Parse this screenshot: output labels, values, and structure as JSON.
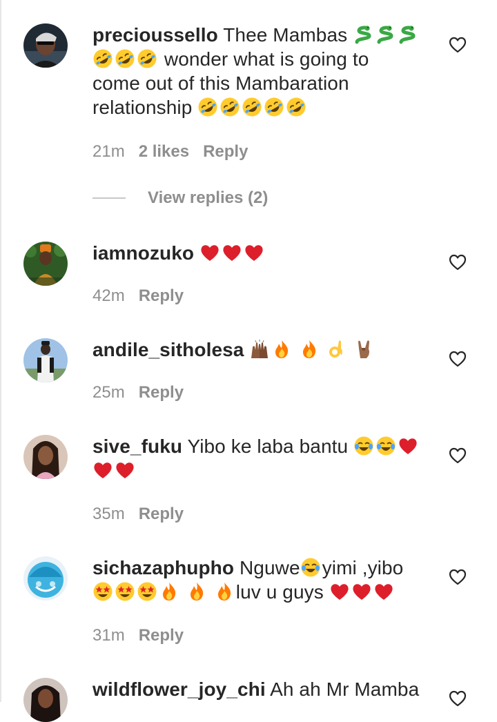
{
  "comments": [
    {
      "username": "precioussello",
      "text_1": "Thee Mambas",
      "text_2": "wonder what is going to",
      "text_3": "come out of this Mambaration",
      "text_4": "relationship",
      "time": "21m",
      "likes": "2 likes",
      "reply": "Reply",
      "view_replies": "View replies (2)"
    },
    {
      "username": "iamnozuko",
      "time": "42m",
      "reply": "Reply"
    },
    {
      "username": "andile_sitholesa",
      "time": "25m",
      "reply": "Reply"
    },
    {
      "username": "sive_fuku",
      "text_1": "Yibo ke laba bantu",
      "time": "35m",
      "reply": "Reply"
    },
    {
      "username": "sichazaphupho",
      "text_1": "Nguwe",
      "text_2": "yimi ,yibo",
      "text_3": "luv u guys",
      "time": "31m",
      "reply": "Reply"
    },
    {
      "username": "wildflower_joy_chi",
      "text_1": "Ah ah Mr Mamba"
    }
  ],
  "icons": {
    "like": "heart-outline-icon",
    "snake": "snake-emoji",
    "rofl": "rofl-emoji",
    "heart": "red-heart-emoji",
    "fire": "fire-emoji",
    "raised_hands": "raised-hands-emoji",
    "ok_hand": "ok-hand-emoji",
    "rock_on": "rock-on-emoji",
    "tears_of_joy": "tears-of-joy-emoji",
    "star_struck": "star-struck-emoji"
  },
  "colors": {
    "text": "#262626",
    "secondary": "#8e8e8e",
    "heart_red": "#dd1f2b"
  }
}
